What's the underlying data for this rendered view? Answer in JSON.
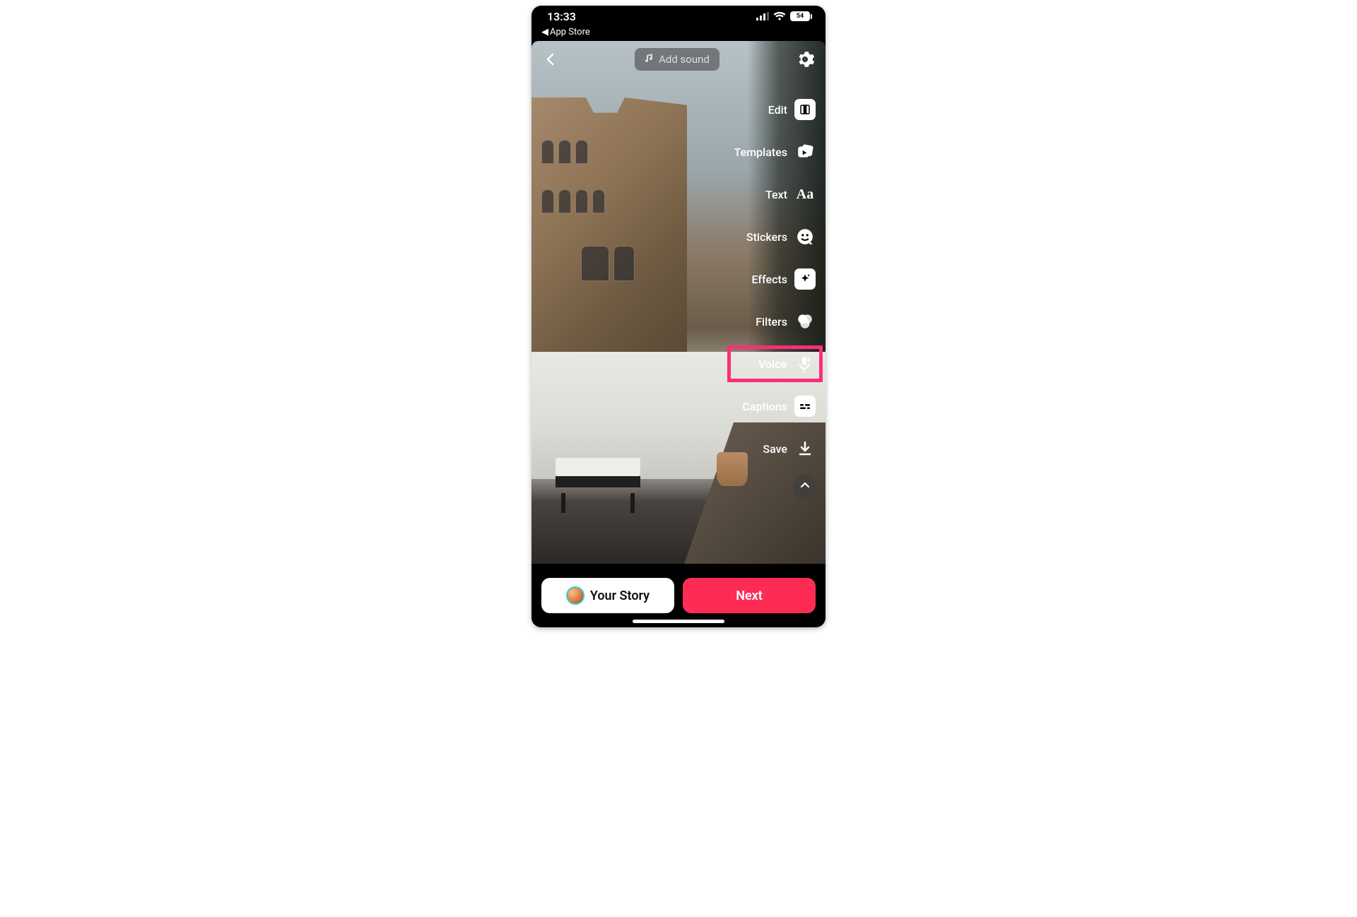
{
  "status": {
    "time": "13:33",
    "back_app_label": "App Store",
    "battery_percent": "54"
  },
  "top": {
    "add_sound_label": "Add sound"
  },
  "sidebar": {
    "items": [
      {
        "label": "Edit"
      },
      {
        "label": "Templates"
      },
      {
        "label": "Text"
      },
      {
        "label": "Stickers"
      },
      {
        "label": "Effects"
      },
      {
        "label": "Filters"
      },
      {
        "label": "Voice"
      },
      {
        "label": "Captions"
      },
      {
        "label": "Save"
      }
    ],
    "highlighted_index": 6
  },
  "bottom": {
    "story_label": "Your Story",
    "next_label": "Next"
  },
  "colors": {
    "accent_pink": "#fe2c55",
    "highlight_magenta": "#ff2d78"
  }
}
